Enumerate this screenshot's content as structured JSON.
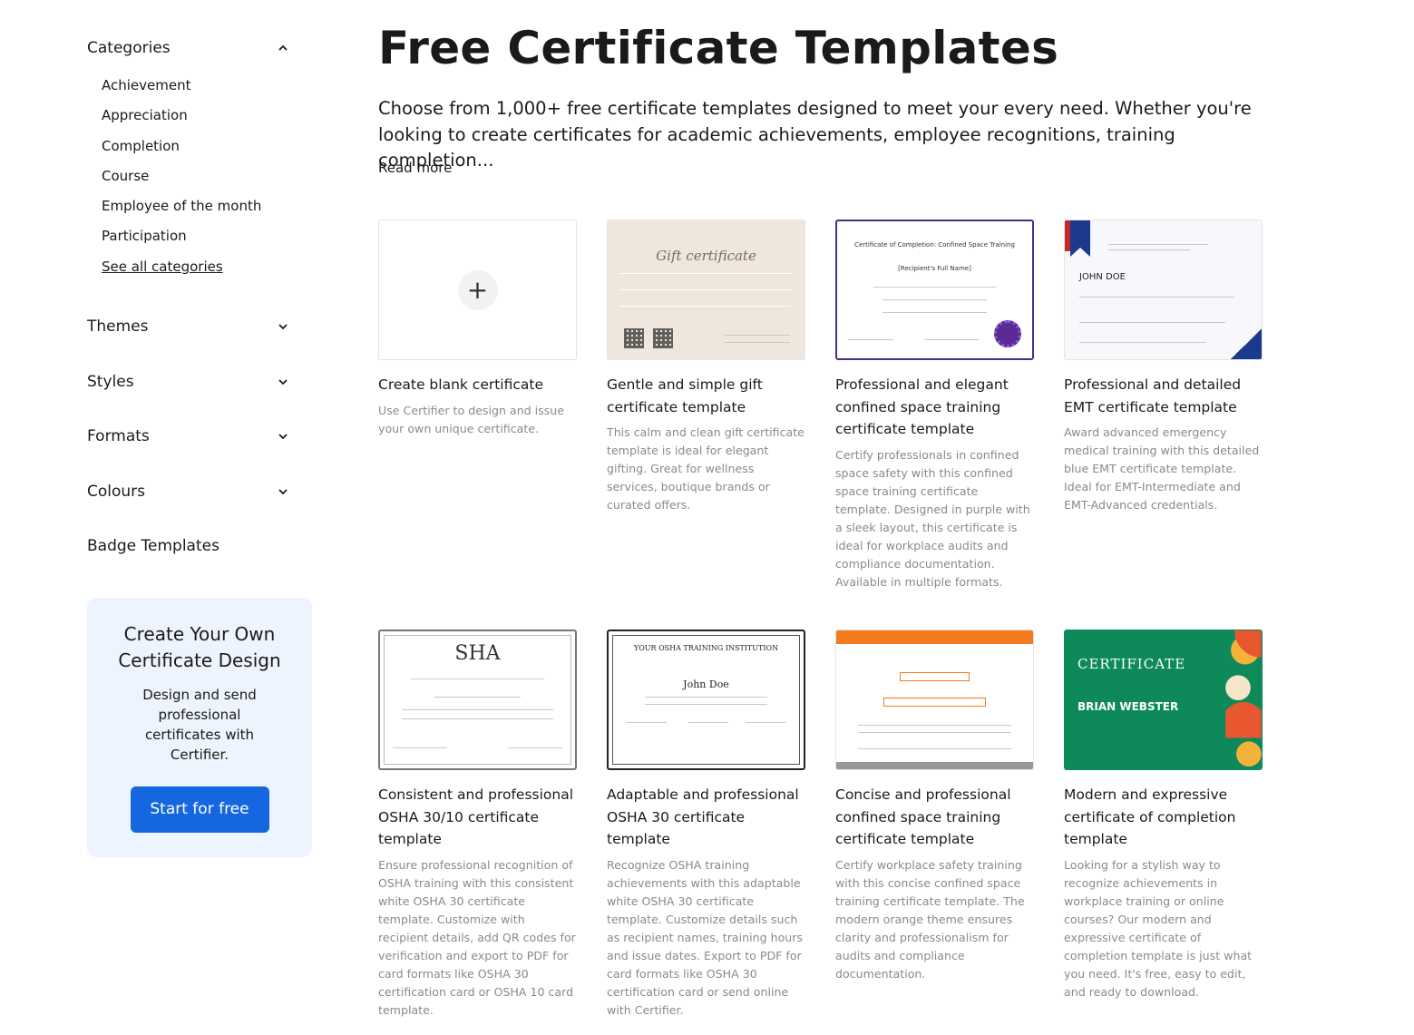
{
  "sidebar": {
    "categories_title": "Categories",
    "categories": [
      "Achievement",
      "Appreciation",
      "Completion",
      "Course",
      "Employee of the month",
      "Participation"
    ],
    "see_all": "See all categories",
    "sections": [
      "Themes",
      "Styles",
      "Formats",
      "Colours"
    ],
    "badge_templates": "Badge Templates",
    "promo": {
      "title": "Create Your Own Certificate Design",
      "text": "Design and send professional certificates with Certifier.",
      "button": "Start for free"
    }
  },
  "main": {
    "title": "Free Certificate Templates",
    "intro": "Choose from 1,000+ free certificate templates designed to meet your every need. Whether you're looking to create certificates for academic achievements, employee recognitions, training completion...",
    "read_more": "Read more",
    "cards": [
      {
        "name": "Create blank certificate",
        "desc": "Use Certifier to design and issue your own unique certificate."
      },
      {
        "name": "Gentle and simple gift certificate template",
        "desc": "This calm and clean gift certificate template is ideal for elegant gifting. Great for wellness services, boutique brands or curated offers.",
        "thumb_text": "Gift certificate"
      },
      {
        "name": "Professional and elegant confined space training certificate template",
        "desc": "Certify professionals in confined space safety with this confined space training certificate template. Designed in purple with a sleek layout, this certificate is ideal for workplace audits and compliance documentation. Available in multiple formats.",
        "thumb_text": "Certificate of Completion: Confined Space Training",
        "thumb_sub": "[Recipient's Full Name]"
      },
      {
        "name": "Professional and detailed EMT certificate template",
        "desc": "Award advanced emergency medical training with this detailed blue EMT certificate template. Ideal for EMT-Intermediate and EMT-Advanced credentials.",
        "thumb_text": "JOHN DOE"
      },
      {
        "name": "Consistent and professional OSHA 30/10 certificate template",
        "desc": "Ensure professional recognition of OSHA training with this consistent white OSHA 30 certificate template. Customize with recipient details, add QR codes for verification and export to PDF for card formats like OSHA 30 certification card or OSHA 10 card template.",
        "thumb_text": "SHA"
      },
      {
        "name": "Adaptable and professional OSHA 30 certificate template",
        "desc": "Recognize OSHA training achievements with this adaptable white OSHA 30 certificate template. Customize details such as recipient names, training hours and issue dates. Export to PDF for card formats like OSHA 30 certification card or send online with Certifier.",
        "thumb_text": "YOUR OSHA TRAINING INSTITUTION",
        "thumb_sub": "John Doe"
      },
      {
        "name": "Concise and professional confined space training certificate template",
        "desc": "Certify workplace safety training with this concise confined space training certificate template. The modern orange theme ensures clarity and professionalism for audits and compliance documentation."
      },
      {
        "name": "Modern and expressive certificate of completion template",
        "desc": "Looking for a stylish way to recognize achievements in workplace training or online courses? Our modern and expressive certificate of completion template is just what you need. It's free, easy to edit, and ready to download.",
        "thumb_text": "CERTIFICATE",
        "thumb_sub": "BRIAN WEBSTER"
      }
    ]
  },
  "colors": {
    "accent": "#1567e0",
    "promo_bg": "#eef4fd",
    "purple": "#4b2b87",
    "orange": "#f47a1f",
    "green": "#0e8a5a",
    "emt_blue": "#1b3a8c"
  }
}
